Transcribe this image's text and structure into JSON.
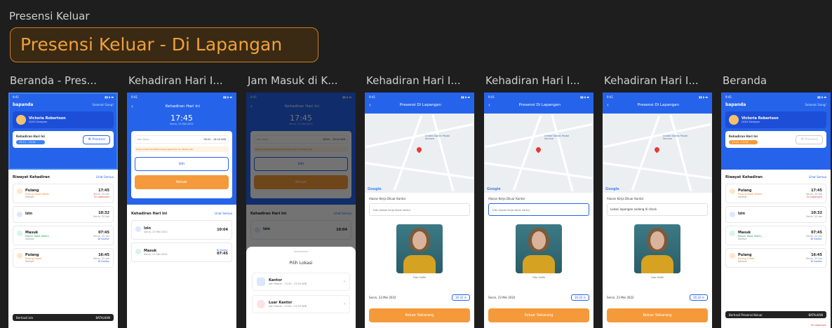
{
  "page_label": "Presensi Keluar",
  "section_title": "Presensi Keluar - Di Lapangan",
  "frames": [
    {
      "title": "Beranda - Pres..."
    },
    {
      "title": "Kehadiran Hari I..."
    },
    {
      "title": "Jam Masuk di K..."
    },
    {
      "title": "Kehadiran Hari I..."
    },
    {
      "title": "Kehadiran Hari I..."
    },
    {
      "title": "Kehadiran Hari I..."
    },
    {
      "title": "Beranda"
    }
  ],
  "home": {
    "logo": "bapanda",
    "greeting": "Selamat Siang!",
    "user_name": "Victoria Robertson",
    "user_role": "UI/UX Designer",
    "today_label": "Kehadiran Hari Ini",
    "today_chip": "12:11 - 13:24",
    "presensi_button": "Presensi",
    "history_title": "Riwayat Kehadiran",
    "see_all": "Lihat Semua",
    "items": [
      {
        "type": "Pulang",
        "note": "Pulang Tepat Waktu",
        "sub": "Selesai",
        "time": "17:45",
        "date": "Senin, 20 Jan",
        "place": "Di Lapangan"
      },
      {
        "type": "Izin",
        "note": "",
        "sub": "",
        "time": "10:32",
        "date": "Senin, 20 Jan",
        "place": ""
      },
      {
        "type": "Masuk",
        "note": "Masuk Tepat Waktu",
        "sub": "Selesai",
        "time": "07:45",
        "date": "Senin, 20 Jan",
        "place": "Di Kantor"
      },
      {
        "type": "Pulang",
        "note": "Pulang Cepat",
        "sub": "Selesai",
        "time": "16:45",
        "date": "Senin, 20 Jan",
        "place": "Di Kantor"
      }
    ],
    "toast_left": "Berhasil izin",
    "toast_right": "BATALKAN",
    "toast_left2": "Berhasil Presensi Keluar",
    "toast_right2": "BATALKAN",
    "last_place": "Di Lapangan"
  },
  "attendance": {
    "header": "Kehadiran Hari Ini",
    "clock": "17:45",
    "date": "Senin, 23 Mei 2022",
    "jam_kerja_label": "Jam Kerja",
    "jam_kerja_value": "08:00 - 16:00 WIB",
    "warning": "Kamu sudah tercatat pulang cepat hari ini. Mohon izin",
    "izin_button": "Izin",
    "keluar_button": "Keluar",
    "today_section": "Kehadiran Hari Ini",
    "see_all": "Lihat Semua",
    "items": [
      {
        "type": "Izin",
        "date": "Senin, 23 Mei 2022",
        "time": "10:04",
        "place": ""
      },
      {
        "type": "Masuk",
        "date": "Senin, 23 Mei 2022",
        "time": "07:45",
        "place": "Di Kantor"
      }
    ]
  },
  "location_sheet": {
    "title": "Pilih Lokasi",
    "options": [
      {
        "name": "Kantor",
        "hours": "Jam Masuk : 13:30 - 23:59 WIB"
      },
      {
        "name": "Luar Kantor",
        "hours": "Jam Masuk : 13:00 - 23:59 WIB"
      }
    ]
  },
  "field": {
    "header": "Presensi Di Lapangan",
    "map_label": "United States Postal Service",
    "map_brand": "Google",
    "reason_label": "Alasan Kerja Diluar Kantor",
    "reason_placeholder": "Tulis alasan kerja diluar kantor",
    "reason_filled": "Lokasi lapangan sedang di check",
    "selfie_caption": "Foto Selfie",
    "date": "Senin, 23 Mei 2022",
    "time": "16:32",
    "submit": "Keluar Sekarang"
  },
  "colors": {
    "accent": "#2563eb",
    "orange": "#f59a3a",
    "section_border": "#c77f1a"
  }
}
